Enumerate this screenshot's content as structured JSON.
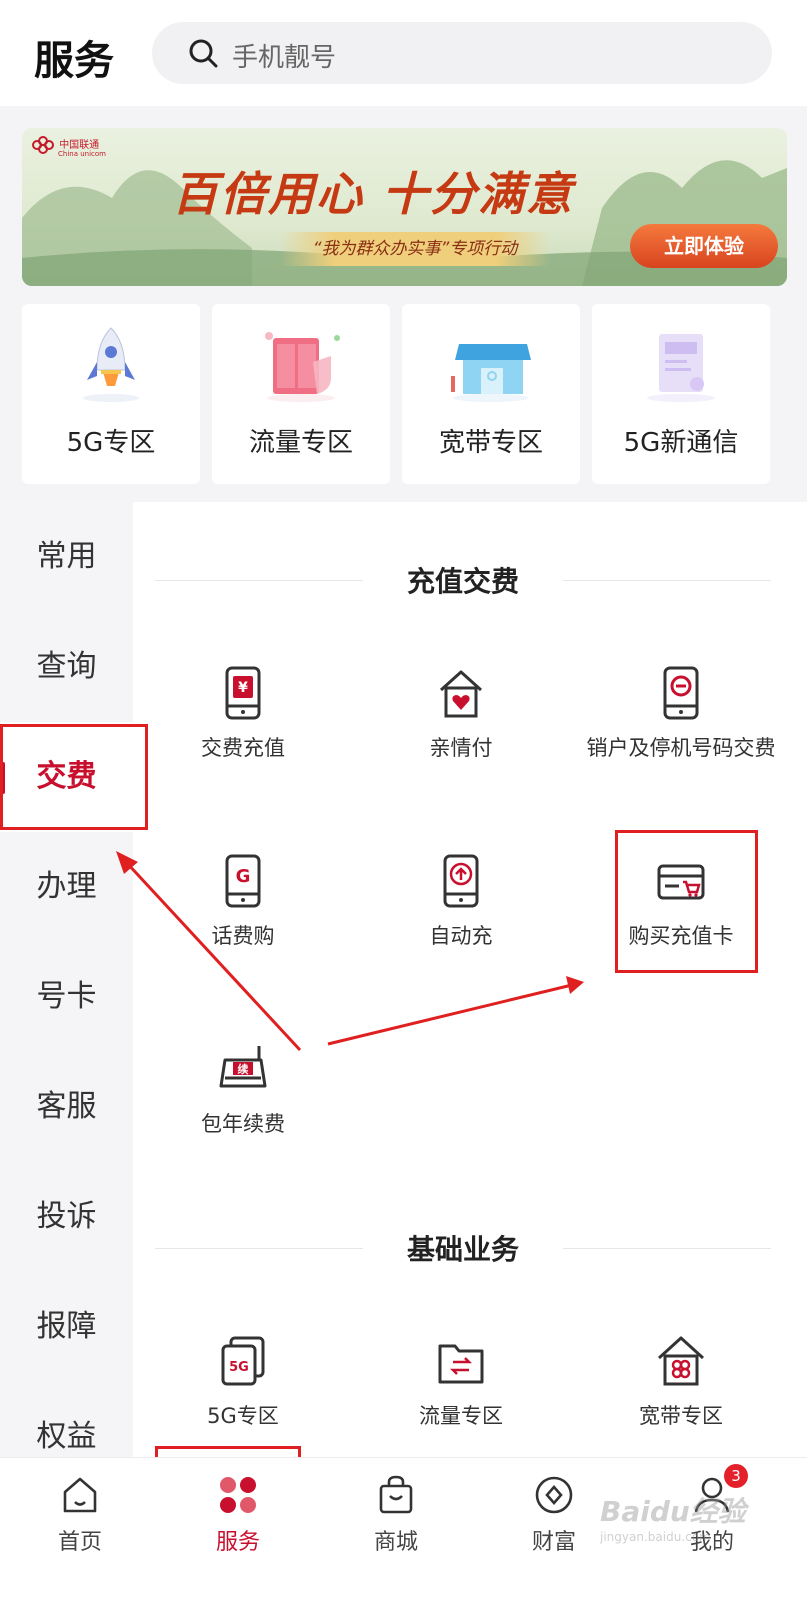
{
  "header": {
    "title": "服务",
    "search_placeholder": "手机靓号"
  },
  "banner": {
    "brand": "中国联通",
    "brand_en": "China unicom",
    "headline": "百倍用心 十分满意",
    "subline": "“我为群众办实事”专项行动",
    "cta": "立即体验"
  },
  "zones": [
    {
      "label": "5G专区",
      "icon": "rocket-icon"
    },
    {
      "label": "流量专区",
      "icon": "data-package-icon"
    },
    {
      "label": "宽带专区",
      "icon": "broadband-store-icon"
    },
    {
      "label": "5G新通信",
      "icon": "new-message-icon"
    }
  ],
  "sidenav": {
    "items": [
      "常用",
      "查询",
      "交费",
      "办理",
      "号卡",
      "客服",
      "投诉",
      "报障",
      "权益"
    ],
    "active": "交费"
  },
  "sections": [
    {
      "title": "充值交费",
      "items": [
        {
          "label": "交费充值",
          "icon": "phone-yuan-icon"
        },
        {
          "label": "亲情付",
          "icon": "home-heart-icon"
        },
        {
          "label": "销户及停机号码交费",
          "icon": "phone-minus-icon"
        },
        {
          "label": "话费购",
          "icon": "phone-g-icon"
        },
        {
          "label": "自动充",
          "icon": "phone-auto-recharge-icon"
        },
        {
          "label": "购买充值卡",
          "icon": "recharge-card-cart-icon"
        },
        {
          "label": "包年续费",
          "icon": "router-renew-icon"
        }
      ]
    },
    {
      "title": "基础业务",
      "items": [
        {
          "label": "5G专区",
          "icon": "5g-cards-icon"
        },
        {
          "label": "流量专区",
          "icon": "folder-transfer-icon"
        },
        {
          "label": "宽带专区",
          "icon": "home-unicom-icon"
        }
      ]
    }
  ],
  "tabbar": {
    "tabs": [
      {
        "label": "首页",
        "icon": "home-icon"
      },
      {
        "label": "服务",
        "icon": "service-clover-icon"
      },
      {
        "label": "商城",
        "icon": "shopping-bag-icon"
      },
      {
        "label": "财富",
        "icon": "wealth-icon"
      },
      {
        "label": "我的",
        "icon": "profile-icon"
      }
    ],
    "active": "服务",
    "badge": "3"
  },
  "watermark": {
    "main": "Baidu经验",
    "sub": "jingyan.baidu.com"
  },
  "colors": {
    "accent": "#c8102e",
    "annotation": "#e02020",
    "cta": "#d8431f"
  }
}
